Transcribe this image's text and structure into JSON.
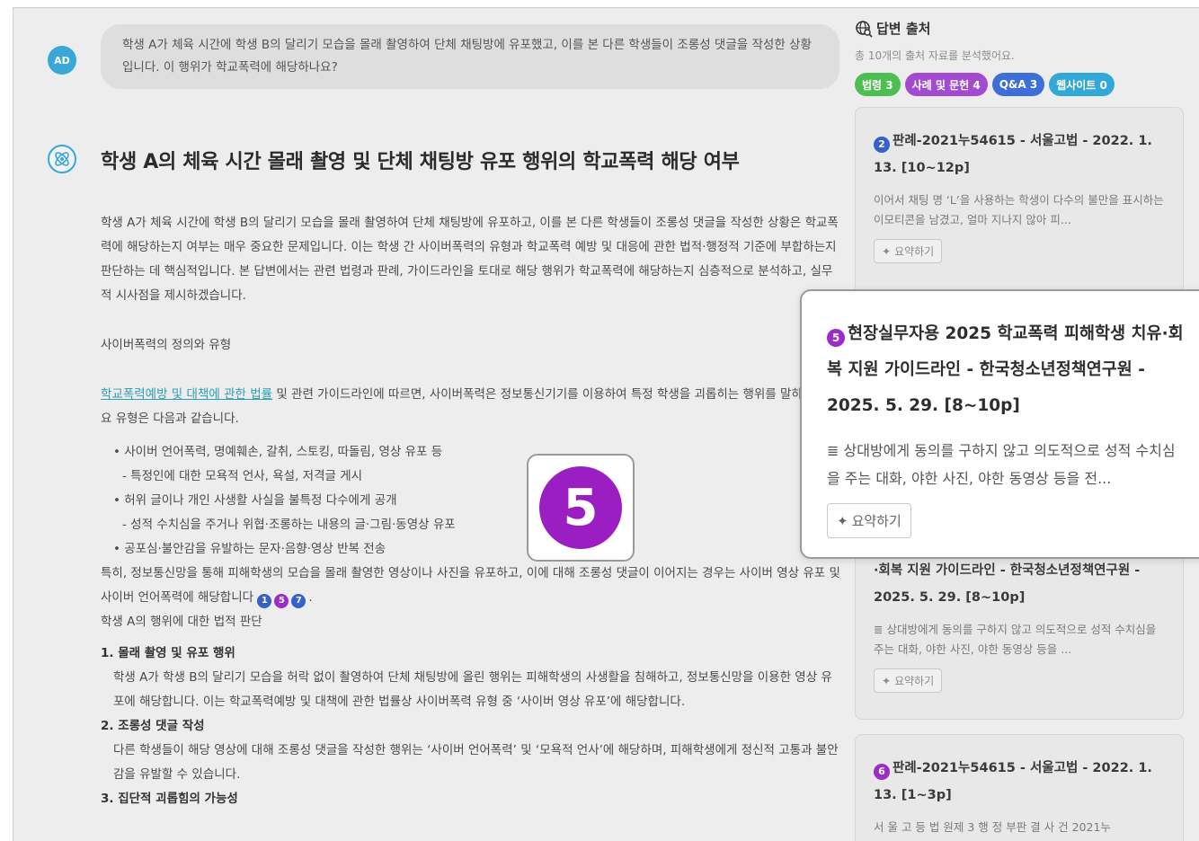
{
  "user": {
    "avatar_text": "AD",
    "question": "학생 A가 체육 시간에 학생 B의 달리기 모습을 몰래 촬영하여 단체 채팅방에 유포했고, 이를 본 다른 학생들이 조롱성 댓글을 작성한 상황입니다. 이 행위가 학교폭력에 해당하나요?"
  },
  "answer": {
    "title": "학생 A의 체육 시간 몰래 촬영 및 단체 채팅방 유포 행위의 학교폭력 해당 여부",
    "intro": "학생 A가 체육 시간에 학생 B의 달리기 모습을 몰래 촬영하여 단체 채팅방에 유포하고, 이를 본 다른 학생들이 조롱성 댓글을 작성한 상황은 학교폭력에 해당하는지 여부는 매우 중요한 문제입니다. 이는 학생 간 사이버폭력의 유형과 학교폭력 예방 및 대응에 관한 법적·행정적 기준에 부합하는지 판단하는 데 핵심적입니다. 본 답변에서는 관련 법령과 판례, 가이드라인을 토대로 해당 행위가 학교폭력에 해당하는지 심층적으로 분석하고, 실무적 시사점을 제시하겠습니다.",
    "section1_heading": "사이버폭력의 정의와 유형",
    "law_link": "학교폭력예방 및 대책에 관한 법률",
    "definition_rest": " 및 관련 가이드라인에 따르면, 사이버폭력은 정보통신기기를 이용하여 특정 학생을 괴롭히는 행위를 말하며, 주요 유형은 다음과 같습니다.",
    "bullets": [
      "• 사이버 언어폭력, 명예훼손, 갈취, 스토킹, 따돌림, 영상 유포 등",
      "- 특정인에 대한 모욕적 언사, 욕설, 저격글 게시",
      "• 허위 글이나 개인 사생활 사실을 불특정 다수에게 공개",
      "- 성적 수치심을 주거나 위협·조롱하는 내용의 글·그림·동영상 유포",
      "• 공포심·불안감을 유발하는 문자·음향·영상 반복 전송"
    ],
    "special": "특히, 정보통신망을 통해 피해학생의 모습을 몰래 촬영한 영상이나 사진을 유포하고, 이에 대해 조롱성 댓글이 이어지는 경우는 사이버 영상 유포 및 사이버 언어폭력에 해당합니다",
    "special_cites": [
      "1",
      "5",
      "7"
    ],
    "special_end": ".",
    "section2_heading": "학생 A의 행위에 대한 법적 판단",
    "items": [
      {
        "title": "1. 몰래 촬영 및 유포 행위",
        "body": "학생 A가 학생 B의 달리기 모습을 허락 없이 촬영하여 단체 채팅방에 올린 행위는 피해학생의 사생활을 침해하고, 정보통신망을 이용한 영상 유포에 해당합니다. 이는 학교폭력예방 및 대책에 관한 법률상 사이버폭력 유형 중 ‘사이버 영상 유포’에 해당합니다."
      },
      {
        "title": "2. 조롱성 댓글 작성",
        "body": "다른 학생들이 해당 영상에 대해 조롱성 댓글을 작성한 행위는 ‘사이버 언어폭력’ 및 ‘모욕적 언사’에 해당하며, 피해학생에게 정신적 고통과 불안감을 유발할 수 있습니다."
      },
      {
        "title": "3. 집단적 괴롭힘의 가능성",
        "body": ""
      }
    ]
  },
  "sidebar": {
    "heading": "답변 출처",
    "summary": "총 10개의 출처 자료를 분석했어요.",
    "tags": [
      {
        "label": "법령 3",
        "color": "#4cbf50"
      },
      {
        "label": "사례 및 문헌 4",
        "color": "#a34bd0"
      },
      {
        "label": "Q&A 3",
        "color": "#3e6ed8"
      },
      {
        "label": "웹사이트 0",
        "color": "#32a8d8"
      }
    ],
    "cards": [
      {
        "num": "2",
        "num_color": "#3661c8",
        "title": "판례-2021누54615 - 서울고법 - 2022. 1. 13. [10~12p]",
        "snippet": "이어서 채팅 명 ‘L’을 사용하는 학생이 다수의 불만을 표시하는 이모티콘을 남겼고, 얼마 지나지 않아 피...",
        "button": "요약하기"
      },
      {
        "num": "",
        "num_color": "#9b2cc7",
        "title": "·회복 지원 가이드라인 - 한국청소년정책연구원 - 2025. 5. 29. [8~10p]",
        "snippet": "상대방에게 동의를 구하지 않고 의도적으로 성적 수치심을 주는 대화, 야한 사진, 야한 동영상 등을 ...",
        "button": "요약하기"
      },
      {
        "num": "6",
        "num_color": "#9b2cc7",
        "title": "판례-2021누54615 - 서울고법 - 2022. 1. 13. [1~3p]",
        "snippet": "서 울 고 등 법 원제 3 행 정 부판 결 사 건 2021누",
        "button": ""
      }
    ]
  },
  "popup": {
    "num": "5",
    "title": "현장실무자용 2025 학교폭력 피해학생 치유·회복 지원 가이드라인 - 한국청소년정책연구원 - 2025. 5. 29. [8~10p]",
    "snippet": "상대방에게 동의를 구하지 않고 의도적으로 성적 수치심을 주는 대화, 야한 사진, 야한 동영상 등을 전...",
    "button": "요약하기"
  },
  "badge": {
    "num": "5"
  }
}
